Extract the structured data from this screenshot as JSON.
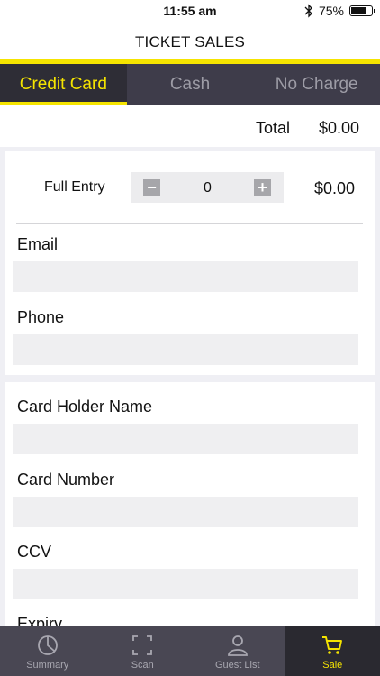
{
  "status": {
    "time": "11:55 am",
    "battery": "75%",
    "battery_level": 0.75,
    "icons": [
      "bluetooth-icon",
      "battery-icon"
    ]
  },
  "nav": {
    "title": "TICKET SALES"
  },
  "payment_tabs": [
    {
      "label": "Credit Card",
      "active": true
    },
    {
      "label": "Cash",
      "active": false
    },
    {
      "label": "No Charge",
      "active": false
    }
  ],
  "total": {
    "label": "Total",
    "value": "$0.00"
  },
  "entry": {
    "label": "Full Entry",
    "quantity": "0",
    "price": "$0.00",
    "minus_icon": "minus-icon",
    "plus_icon": "plus-icon"
  },
  "contact": {
    "email": {
      "label": "Email",
      "value": "",
      "placeholder": ""
    },
    "phone": {
      "label": "Phone",
      "value": "",
      "placeholder": ""
    }
  },
  "card": {
    "holder_name": {
      "label": "Card Holder Name",
      "value": "",
      "placeholder": ""
    },
    "number": {
      "label": "Card Number",
      "value": "",
      "placeholder": ""
    },
    "ccv": {
      "label": "CCV",
      "value": "",
      "placeholder": ""
    },
    "expiry": {
      "label": "Expiry"
    }
  },
  "tab_bar": [
    {
      "label": "Summary",
      "icon": "summary-icon",
      "active": false
    },
    {
      "label": "Scan",
      "icon": "scan-icon",
      "active": false
    },
    {
      "label": "Guest List",
      "icon": "guest-list-icon",
      "active": false
    },
    {
      "label": "Sale",
      "icon": "cart-icon",
      "active": true
    }
  ],
  "colors": {
    "accent": "#f5e400",
    "dark": "#3e3c4a",
    "tab_bar": "#494753",
    "active_tab": "#2a2930",
    "background": "#efeff4"
  }
}
